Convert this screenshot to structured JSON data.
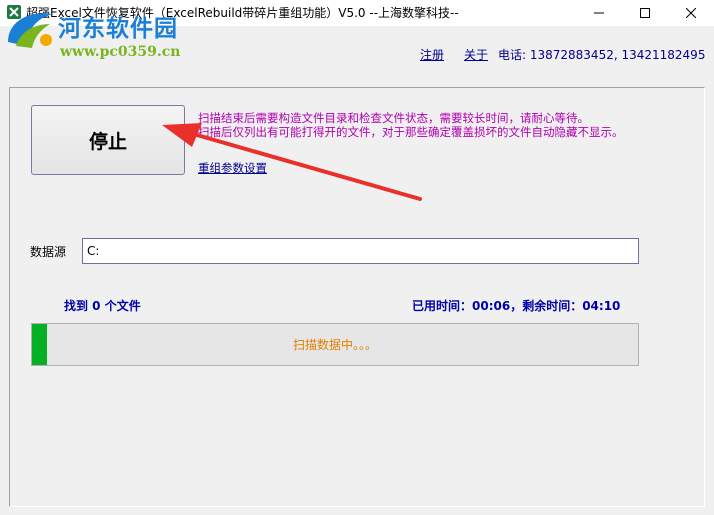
{
  "window": {
    "title": "超强Excel文件恢复软件（ExcelRebuild带碎片重组功能）V5.0  --上海数擎科技--"
  },
  "watermark": {
    "title": "河东软件园",
    "url": "www.pc0359.cn"
  },
  "menu": {
    "register": "注册",
    "about": "关于",
    "phone": "电话: 13872883452, 13421182495"
  },
  "action": {
    "stop_label": "停止"
  },
  "info": {
    "line1": "扫描结束后需要构造文件目录和检查文件状态，需要较长时间，请耐心等待。",
    "line2": "扫描后仅列出有可能打得开的文件，对于那些确定覆盖损坏的文件自动隐藏不显示。",
    "params_link": "重组参数设置"
  },
  "source": {
    "label": "数据源",
    "value": "C:"
  },
  "status": {
    "found": "找到 0 个文件",
    "time": "已用时间：00:06，剩余时间：04:10"
  },
  "progress": {
    "percent": 2.4,
    "label": "扫描数据中。。。",
    "fill_color": "#06b025"
  },
  "annotation": {
    "arrow_color": "#e8312a"
  },
  "icons": {
    "app": "excel-app-icon",
    "minimize": "minimize-icon",
    "maximize": "maximize-icon",
    "close": "close-icon"
  }
}
